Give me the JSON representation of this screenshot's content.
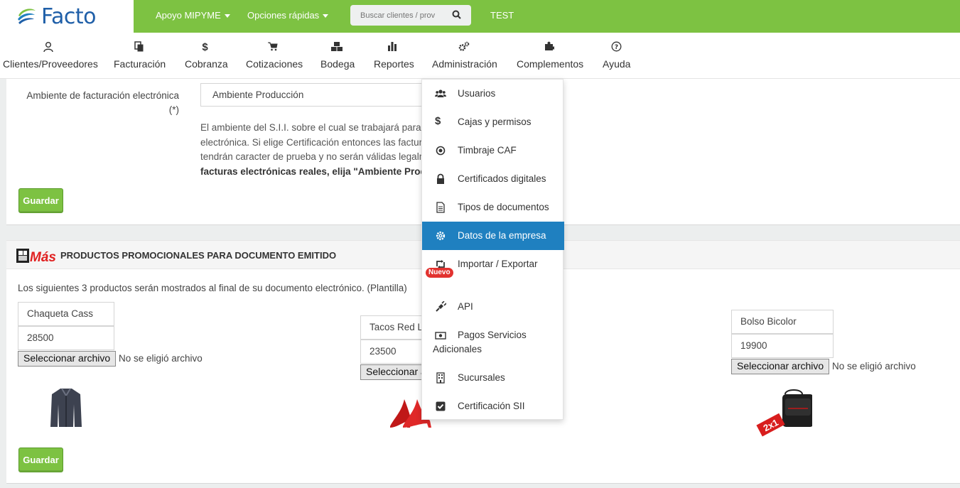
{
  "brand": {
    "name": "Facto"
  },
  "topbar": {
    "apoyo": "Apoyo MIPYME",
    "opciones": "Opciones rápidas",
    "search_placeholder": "Buscar clientes / prov",
    "test": "TEST"
  },
  "menu": [
    {
      "label": "Clientes/Proveedores",
      "icon": "user-icon"
    },
    {
      "label": "Facturación",
      "icon": "documents-icon"
    },
    {
      "label": "Cobranza",
      "icon": "dollar-icon"
    },
    {
      "label": "Cotizaciones",
      "icon": "cart-icon"
    },
    {
      "label": "Bodega",
      "icon": "boxes-icon"
    },
    {
      "label": "Reportes",
      "icon": "bar-chart-icon"
    },
    {
      "label": "Administración",
      "icon": "gears-icon"
    },
    {
      "label": "Complementos",
      "icon": "puzzle-icon"
    },
    {
      "label": "Ayuda",
      "icon": "question-icon"
    }
  ],
  "ambiente": {
    "label_line1": "Ambiente de facturación electrónica",
    "label_line2": "(*)",
    "value": "Ambiente Producción",
    "help_lines": [
      "El ambiente del S.I.I. sobre el cual se trabajará para la",
      "electrónica. Si elige Certificación entonces las factura",
      "tendrán caracter de prueba y no serán válidas legalm"
    ],
    "help_bold": "facturas electrónicas reales, elija \"Ambiente Produ",
    "save": "Guardar"
  },
  "promo": {
    "logo_text": "Más",
    "title": "PRODUCTOS PROMOCIONALES PARA DOCUMENTO EMITIDO",
    "description": "Los siguientes 3 productos serán mostrados al final de su documento electrónico. (Plantilla)",
    "products": [
      {
        "name": "Chaqueta Cass",
        "price": "28500",
        "file_button": "Seleccionar archivo",
        "file_status": "No se eligió archivo"
      },
      {
        "name": "Tacos Red Li",
        "price": "23500",
        "file_button": "Seleccionar a",
        "file_status": ""
      },
      {
        "name": "Bolso Bicolor",
        "price": "19900",
        "file_button": "Seleccionar archivo",
        "file_status": "No se eligió archivo"
      }
    ],
    "bag_tag": "2x1",
    "save": "Guardar"
  },
  "dropdown": {
    "items": [
      {
        "label": "Usuarios",
        "icon": "users-icon"
      },
      {
        "label": "Cajas y permisos",
        "icon": "dollar-icon"
      },
      {
        "label": "Timbraje CAF",
        "icon": "target-icon"
      },
      {
        "label": "Certificados digitales",
        "icon": "lock-icon"
      },
      {
        "label": "Tipos de documentos",
        "icon": "file-icon"
      },
      {
        "label": "Datos de la empresa",
        "icon": "gear-icon",
        "active": true
      },
      {
        "label": "Importar / Exportar",
        "icon": "retweet-icon",
        "badge": "Nuevo"
      },
      {
        "label": "API",
        "icon": "plug-icon"
      },
      {
        "label": "Pagos Servicios",
        "label2": "Adicionales",
        "icon": "money-icon"
      },
      {
        "label": "Sucursales",
        "icon": "building-icon"
      },
      {
        "label": "Certificación SII",
        "icon": "checkbox-icon"
      }
    ],
    "active_color": "#1f80c0"
  },
  "colors": {
    "brand_green": "#7dc242",
    "brand_blue": "#1f5fa8",
    "active_blue": "#1f80c0"
  }
}
